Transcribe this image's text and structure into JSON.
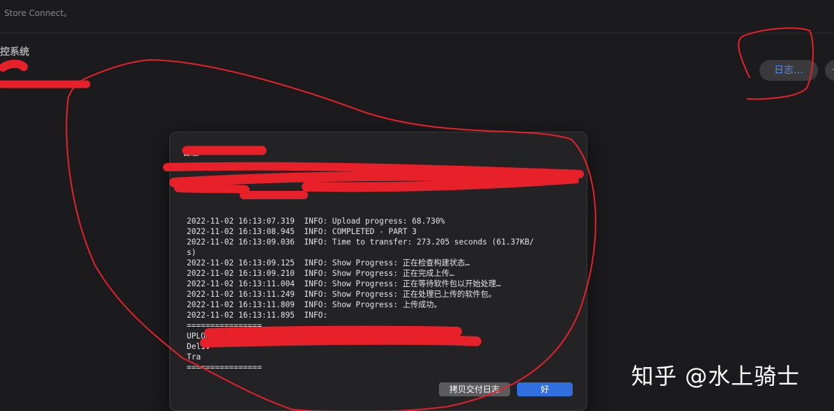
{
  "window": {
    "topbar_text": "Store Connect。",
    "app_title": "控系统",
    "app_subtitle": "",
    "app_subtitle_2": ""
  },
  "header": {
    "log_button_label": "日志…",
    "extra_button_label": "＋"
  },
  "dialog": {
    "title": "日志",
    "log_lines": [
      "",
      "",
      "",
      "",
      "",
      "2022-11-02 16:13:07.319  INFO: Upload progress: 68.730%",
      "2022-11-02 16:13:08.945  INFO: COMPLETED - PART 3",
      "2022-11-02 16:13:09.036  INFO: Time to transfer: 273.205 seconds (61.37KB/",
      "s)",
      "2022-11-02 16:13:09.125  INFO: Show Progress: 正在检查构建状态…",
      "2022-11-02 16:13:09.210  INFO: Show Progress: 正在完成上传…",
      "2022-11-02 16:13:11.004  INFO: Show Progress: 正在等待软件包以开始处理…",
      "2022-11-02 16:13:11.249  INFO: Show Progress: 正在处理已上传的软件包。",
      "2022-11-02 16:13:11.809  INFO: Show Progress: 上传成功。",
      "2022-11-02 16:13:11.895  INFO:",
      "================",
      "UPLOAD SUCCEEDED",
      "Deliv",
      "Tra",
      "================"
    ],
    "copy_button_label": "拷贝交付日志",
    "ok_button_label": "好"
  },
  "watermark": {
    "text": "知乎 @水上骑士"
  },
  "colors": {
    "background": "#1b1b1d",
    "dialog_background": "#232325",
    "accent_blue": "#2f6fe0",
    "link_blue": "#4c8df6",
    "annotation_red": "#e8202a"
  }
}
